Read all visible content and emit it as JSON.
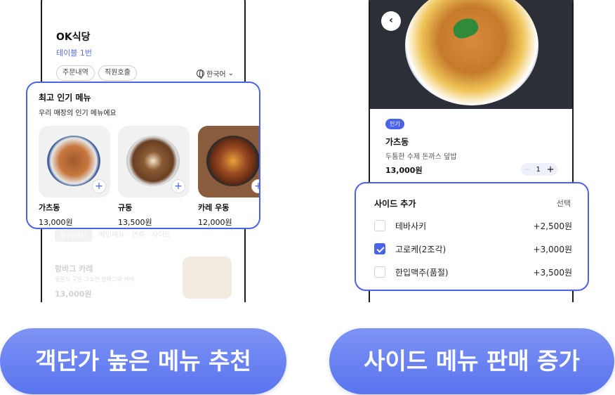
{
  "left_screen": {
    "shop_name": "OK식당",
    "table": "테이블 1번",
    "buttons": [
      "주문내역",
      "직원호출"
    ],
    "language": "한국어",
    "popular": {
      "title": "최고 인기 메뉴",
      "subtitle": "우리 매장의 인기 메뉴에요",
      "items": [
        {
          "name": "가츠동",
          "price": "13,000원"
        },
        {
          "name": "규동",
          "price": "13,500원"
        },
        {
          "name": "카레 우동",
          "price": "12,000원"
        }
      ]
    },
    "categories": [
      "인기메뉴",
      "메인메뉴",
      "면류",
      "사이드"
    ],
    "list_item": {
      "name": "함바그 카레",
      "description": "일본식 구운 고소한 함바그와 카레",
      "price": "13,000원"
    }
  },
  "right_screen": {
    "badge": "인기",
    "dish_name": "가츠동",
    "dish_desc": "두툼한 수제 돈까스 덮밥",
    "dish_price": "13,000원",
    "quantity": "1",
    "side": {
      "title": "사이드 추가",
      "select_label": "선택",
      "options": [
        {
          "label": "테바사키",
          "price": "+2,500원",
          "checked": false
        },
        {
          "label": "고로케(2조각)",
          "price": "+3,000원",
          "checked": true
        },
        {
          "label": "한입맥주(품절)",
          "price": "+3,500원",
          "checked": false
        }
      ]
    }
  },
  "captions": {
    "left": "객단가 높은 메뉴 추천",
    "right": "사이드 메뉴 판매 증가"
  },
  "colors": {
    "accent": "#4a63e8",
    "cta": "#6a82f2"
  }
}
